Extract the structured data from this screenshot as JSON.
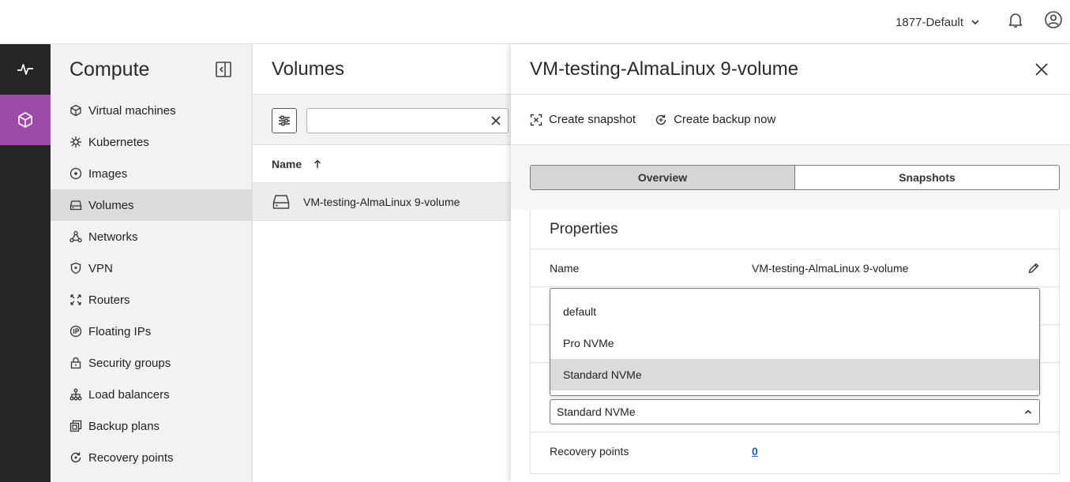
{
  "topbar": {
    "project": "1877-Default",
    "icons": [
      "chevron-down-icon",
      "bell-icon",
      "user-icon"
    ]
  },
  "rail": {
    "items": [
      {
        "icon": "pulse-icon",
        "active": false
      },
      {
        "icon": "cube-icon",
        "active": true
      }
    ],
    "active_color": "#9b4aa8"
  },
  "sidebar": {
    "title": "Compute",
    "items": [
      {
        "label": "Virtual machines",
        "icon": "cube-icon"
      },
      {
        "label": "Kubernetes",
        "icon": "helm-icon"
      },
      {
        "label": "Images",
        "icon": "disc-icon"
      },
      {
        "label": "Volumes",
        "icon": "drive-icon",
        "active": true
      },
      {
        "label": "Networks",
        "icon": "network-icon"
      },
      {
        "label": "VPN",
        "icon": "shield-icon"
      },
      {
        "label": "Routers",
        "icon": "router-icon"
      },
      {
        "label": "Floating IPs",
        "icon": "ip-icon"
      },
      {
        "label": "Security groups",
        "icon": "lock-icon"
      },
      {
        "label": "Load balancers",
        "icon": "balancer-icon"
      },
      {
        "label": "Backup plans",
        "icon": "backup-icon"
      },
      {
        "label": "Recovery points",
        "icon": "recovery-icon"
      }
    ]
  },
  "list": {
    "title": "Volumes",
    "search_value": "",
    "column": "Name",
    "rows": [
      {
        "name": "VM-testing-AlmaLinux 9-volume"
      }
    ]
  },
  "detail": {
    "title": "VM-testing-AlmaLinux 9-volume",
    "actions": {
      "snapshot": "Create snapshot",
      "backup": "Create backup now"
    },
    "tabs": [
      {
        "label": "Overview",
        "active": true
      },
      {
        "label": "Snapshots",
        "active": false
      }
    ],
    "properties": {
      "title": "Properties",
      "name_key": "Name",
      "name_value": "VM-testing-AlmaLinux 9-volume",
      "volume_type_value": "Standard NVMe",
      "recovery_key": "Recovery points",
      "recovery_value": "0"
    },
    "dropdown": {
      "options": [
        "default",
        "Pro NVMe",
        "Standard NVMe"
      ],
      "selected_index": 2
    }
  }
}
